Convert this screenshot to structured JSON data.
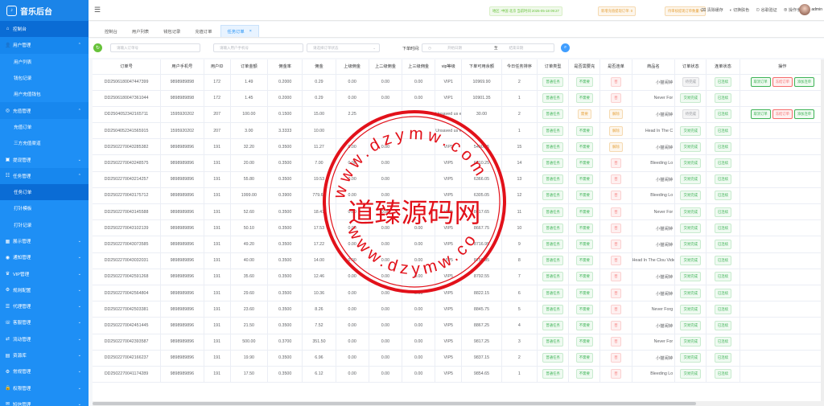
{
  "app": {
    "title": "音乐后台"
  },
  "sidebar": {
    "items": [
      {
        "label": "控制台",
        "icon": "home-icon",
        "level": 0,
        "state": "active"
      },
      {
        "label": "用户管理",
        "icon": "user-icon",
        "level": 0,
        "state": "open"
      },
      {
        "label": "用户列表",
        "level": 1
      },
      {
        "label": "钱包记录",
        "level": 1
      },
      {
        "label": "用户充值钱包",
        "level": 1
      },
      {
        "label": "充值管理",
        "icon": "recharge-icon",
        "level": 0,
        "state": "open"
      },
      {
        "label": "充值订单",
        "level": 1
      },
      {
        "label": "三方充值渠道",
        "level": 1
      },
      {
        "label": "提现管理",
        "icon": "withdraw-icon",
        "level": 0
      },
      {
        "label": "任务管理",
        "icon": "task-icon",
        "level": 0,
        "state": "open"
      },
      {
        "label": "任务订单",
        "level": 1,
        "state": "active"
      },
      {
        "label": "打针模板",
        "level": 1
      },
      {
        "label": "打针记录",
        "level": 1
      },
      {
        "label": "展示管理",
        "icon": "display-icon",
        "level": 0
      },
      {
        "label": "通知管理",
        "icon": "bell-icon",
        "level": 0
      },
      {
        "label": "VIP管理",
        "icon": "vip-icon",
        "level": 0
      },
      {
        "label": "规则配置",
        "icon": "gear-icon",
        "level": 0
      },
      {
        "label": "代理管理",
        "icon": "agent-icon",
        "level": 0
      },
      {
        "label": "客服管理",
        "icon": "service-icon",
        "level": 0
      },
      {
        "label": "流动管理",
        "icon": "flow-icon",
        "level": 0
      },
      {
        "label": "资源库",
        "icon": "folder-icon",
        "level": 0
      },
      {
        "label": "常规管理",
        "icon": "settings-icon",
        "level": 0
      },
      {
        "label": "权限管理",
        "icon": "lock-icon",
        "level": 0
      },
      {
        "label": "短信管理",
        "icon": "sms-icon",
        "level": 0
      }
    ]
  },
  "topbar": {
    "login_info": "地区: 中国 北京 当前时间 2025-05-18 09:27",
    "withdraw_notice": "新增充值提现订单: 0",
    "recharge_notice": "待审核提现订单数量: 0",
    "tools": [
      "清除缓存",
      "切换肤色",
      "谷歌验证",
      "操作手册"
    ],
    "username": "admin"
  },
  "tabs": [
    {
      "label": "控制台"
    },
    {
      "label": "用户列表"
    },
    {
      "label": "钱包记录"
    },
    {
      "label": "充值订单"
    },
    {
      "label": "任务订单",
      "active": true,
      "close": "×"
    }
  ],
  "filters": {
    "refresh_icon": "refresh-icon",
    "order_placeholder": "请输入订单号",
    "phone_placeholder": "请输入用户手机号",
    "status_placeholder": "请选择订单状态",
    "time_label": "下单时间:",
    "start_placeholder": "开始日期",
    "separator": "至",
    "end_placeholder": "结束日期",
    "search_icon": "search-icon"
  },
  "table": {
    "headers": [
      "订单号",
      "用户手机号",
      "用户ID",
      "订单金额",
      "佣金率",
      "佣金",
      "上级佣金",
      "上二级佣金",
      "上三级佣金",
      "vip等级",
      "下单可用余额",
      "今日任务排序",
      "订单类型",
      "是否需要充",
      "是否连单",
      "商品名",
      "订单状态",
      "连单状态",
      "操作"
    ],
    "rows": [
      {
        "c": [
          "DD2506180047447399",
          "9898989898",
          "172",
          "1.49",
          "0.2000",
          "0.29",
          "0.00",
          "0.00",
          "0.00",
          "VIP1",
          "10969.90",
          "2"
        ],
        "type": "普通任务",
        "need": "不需要",
        "link": "否",
        "name": "小猫闹钟",
        "status": "待完成",
        "lstat": "已连续",
        "ops": [
          "取消订单",
          "冻结订单",
          "添加连单"
        ]
      },
      {
        "c": [
          "DD2506180047361044",
          "9898989898",
          "172",
          "1.45",
          "0.2000",
          "0.29",
          "0.00",
          "0.00",
          "0.00",
          "VIP1",
          "10901.35",
          "1"
        ],
        "type": "普通任务",
        "need": "不需要",
        "link": "否",
        "name": "Never For",
        "status": "交易完成",
        "lstat": "已连续",
        "ops": []
      },
      {
        "c": [
          "DD2504052342165711",
          "1595920202",
          "207",
          "100.00",
          "0.1500",
          "15.00",
          "2.25",
          "",
          "",
          "Unsaved us er",
          "30.00",
          "2"
        ],
        "type": "普通任务",
        "need": "需要",
        "link": "解除",
        "name": "小猫闹钟",
        "status": "待完成",
        "lstat": "已连续",
        "ops": [
          "取消订单",
          "冻结订单",
          "添加连单"
        ]
      },
      {
        "c": [
          "DD2504052341565915",
          "1595920202",
          "207",
          "3.00",
          "3.3333",
          "10.00",
          "",
          "",
          "",
          "Unsaved us er",
          "",
          "1"
        ],
        "type": "普通任务",
        "need": "不需要",
        "link": "解除",
        "name": "Head In The C",
        "status": "交易完成",
        "lstat": "已连续",
        "ops": []
      },
      {
        "c": [
          "DD2502270043285382",
          "9898989896",
          "191",
          "32.20",
          "0.3500",
          "11.27",
          "0.00",
          "0.00",
          "",
          "VIP5",
          "5490.25",
          "15"
        ],
        "type": "普通任务",
        "need": "不需要",
        "link": "解除",
        "name": "小猫闹钟",
        "status": "交易完成",
        "lstat": "已连续",
        "ops": []
      },
      {
        "c": [
          "DD2502270043248575",
          "9898989896",
          "191",
          "20.00",
          "0.3500",
          "7.00",
          "0.00",
          "0.00",
          "",
          "VIP5",
          "6010.25",
          "14"
        ],
        "type": "普通任务",
        "need": "不需要",
        "link": "否",
        "name": "Bleeding Lo",
        "status": "交易完成",
        "lstat": "已连续",
        "ops": []
      },
      {
        "c": [
          "DD2502270043214257",
          "9898989896",
          "191",
          "55.80",
          "0.3500",
          "19.53",
          "0.00",
          "0.00",
          "",
          "VIP5",
          "6366.05",
          "13"
        ],
        "type": "普通任务",
        "need": "不需要",
        "link": "否",
        "name": "小猫闹钟",
        "status": "交易完成",
        "lstat": "已连续",
        "ops": []
      },
      {
        "c": [
          "DD2502270043175712",
          "9898989896",
          "191",
          "1999.00",
          "0.3900",
          "779.61",
          "0.00",
          "0.00",
          "",
          "VIP5",
          "6305.05",
          "12"
        ],
        "type": "普通任务",
        "need": "不需要",
        "link": "否",
        "name": "Bleeding Lo",
        "status": "交易完成",
        "lstat": "已连续",
        "ops": []
      },
      {
        "c": [
          "DD2502270043145588",
          "9898989896",
          "191",
          "52.60",
          "0.3500",
          "18.41",
          "0.00",
          "0.00",
          "",
          "VIP5",
          "8617.65",
          "11"
        ],
        "type": "普通任务",
        "need": "不需要",
        "link": "否",
        "name": "Never For",
        "status": "交易完成",
        "lstat": "已连续",
        "ops": []
      },
      {
        "c": [
          "DD2502270043102139",
          "9898989896",
          "191",
          "50.10",
          "0.3500",
          "17.53",
          "0.00",
          "0.00",
          "0.00",
          "VIP5",
          "8667.75",
          "10"
        ],
        "type": "普通任务",
        "need": "不需要",
        "link": "否",
        "name": "小猫闹钟",
        "status": "交易完成",
        "lstat": "已连续",
        "ops": []
      },
      {
        "c": [
          "DD2502270043073585",
          "9898989896",
          "191",
          "49.20",
          "0.3500",
          "17.22",
          "0.00",
          "0.00",
          "0.00",
          "VIP5",
          "8716.95",
          "9"
        ],
        "type": "普通任务",
        "need": "不需要",
        "link": "否",
        "name": "小猫闹钟",
        "status": "交易完成",
        "lstat": "已连续",
        "ops": []
      },
      {
        "c": [
          "DD2502270043032031",
          "9898989896",
          "191",
          "40.00",
          "0.3500",
          "14.00",
          "0.00",
          "0.00",
          "0.00",
          "VIP5",
          "8756.95",
          "8"
        ],
        "type": "普通任务",
        "need": "不需要",
        "link": "否",
        "name": "Head In The Clou Video)",
        "status": "交易完成",
        "lstat": "已连续",
        "ops": []
      },
      {
        "c": [
          "DD2502270042591268",
          "9898989896",
          "191",
          "35.60",
          "0.3500",
          "12.46",
          "0.00",
          "0.00",
          "0.00",
          "VIP5",
          "8792.55",
          "7"
        ],
        "type": "普通任务",
        "need": "不需要",
        "link": "否",
        "name": "小猫闹钟",
        "status": "交易完成",
        "lstat": "已连续",
        "ops": []
      },
      {
        "c": [
          "DD2502270042564804",
          "9898989896",
          "191",
          "29.60",
          "0.3500",
          "10.36",
          "0.00",
          "0.00",
          "0.00",
          "VIP5",
          "8822.15",
          "6"
        ],
        "type": "普通任务",
        "need": "不需要",
        "link": "否",
        "name": "小猫闹钟",
        "status": "交易完成",
        "lstat": "已连续",
        "ops": []
      },
      {
        "c": [
          "DD2502270042503381",
          "9898989896",
          "191",
          "23.60",
          "0.3500",
          "8.26",
          "0.00",
          "0.00",
          "0.00",
          "VIP5",
          "8845.75",
          "5"
        ],
        "type": "普通任务",
        "need": "不需要",
        "link": "否",
        "name": "Never Forg",
        "status": "交易完成",
        "lstat": "已连续",
        "ops": []
      },
      {
        "c": [
          "DD2502270042451445",
          "9898989896",
          "191",
          "21.50",
          "0.3500",
          "7.52",
          "0.00",
          "0.00",
          "0.00",
          "VIP5",
          "8867.25",
          "4"
        ],
        "type": "普通任务",
        "need": "不需要",
        "link": "否",
        "name": "小猫闹钟",
        "status": "交易完成",
        "lstat": "已连续",
        "ops": []
      },
      {
        "c": [
          "DD2502270042393587",
          "9898989896",
          "191",
          "500.00",
          "0.3700",
          "351.50",
          "0.00",
          "0.00",
          "0.00",
          "VIP5",
          "9817.25",
          "3"
        ],
        "type": "普通任务",
        "need": "不需要",
        "link": "否",
        "name": "Never For",
        "status": "交易完成",
        "lstat": "已连续",
        "ops": []
      },
      {
        "c": [
          "DD2502270042166237",
          "9898989896",
          "191",
          "19.90",
          "0.3500",
          "6.96",
          "0.00",
          "0.00",
          "0.00",
          "VIP5",
          "9837.15",
          "2"
        ],
        "type": "普通任务",
        "need": "不需要",
        "link": "否",
        "name": "小猫闹钟",
        "status": "交易完成",
        "lstat": "已连续",
        "ops": []
      },
      {
        "c": [
          "DD2502270041174289",
          "9898989896",
          "191",
          "17.50",
          "0.3500",
          "6.12",
          "0.00",
          "0.00",
          "0.00",
          "VIP5",
          "9854.65",
          "1"
        ],
        "type": "普通任务",
        "need": "不需要",
        "link": "否",
        "name": "Bleeding Lo",
        "status": "交易完成",
        "lstat": "已连续",
        "ops": []
      }
    ]
  },
  "watermark": {
    "title": "道臻源码网",
    "url_top": "www.dzymw.com",
    "url_bottom": "www.dzymw.com"
  }
}
